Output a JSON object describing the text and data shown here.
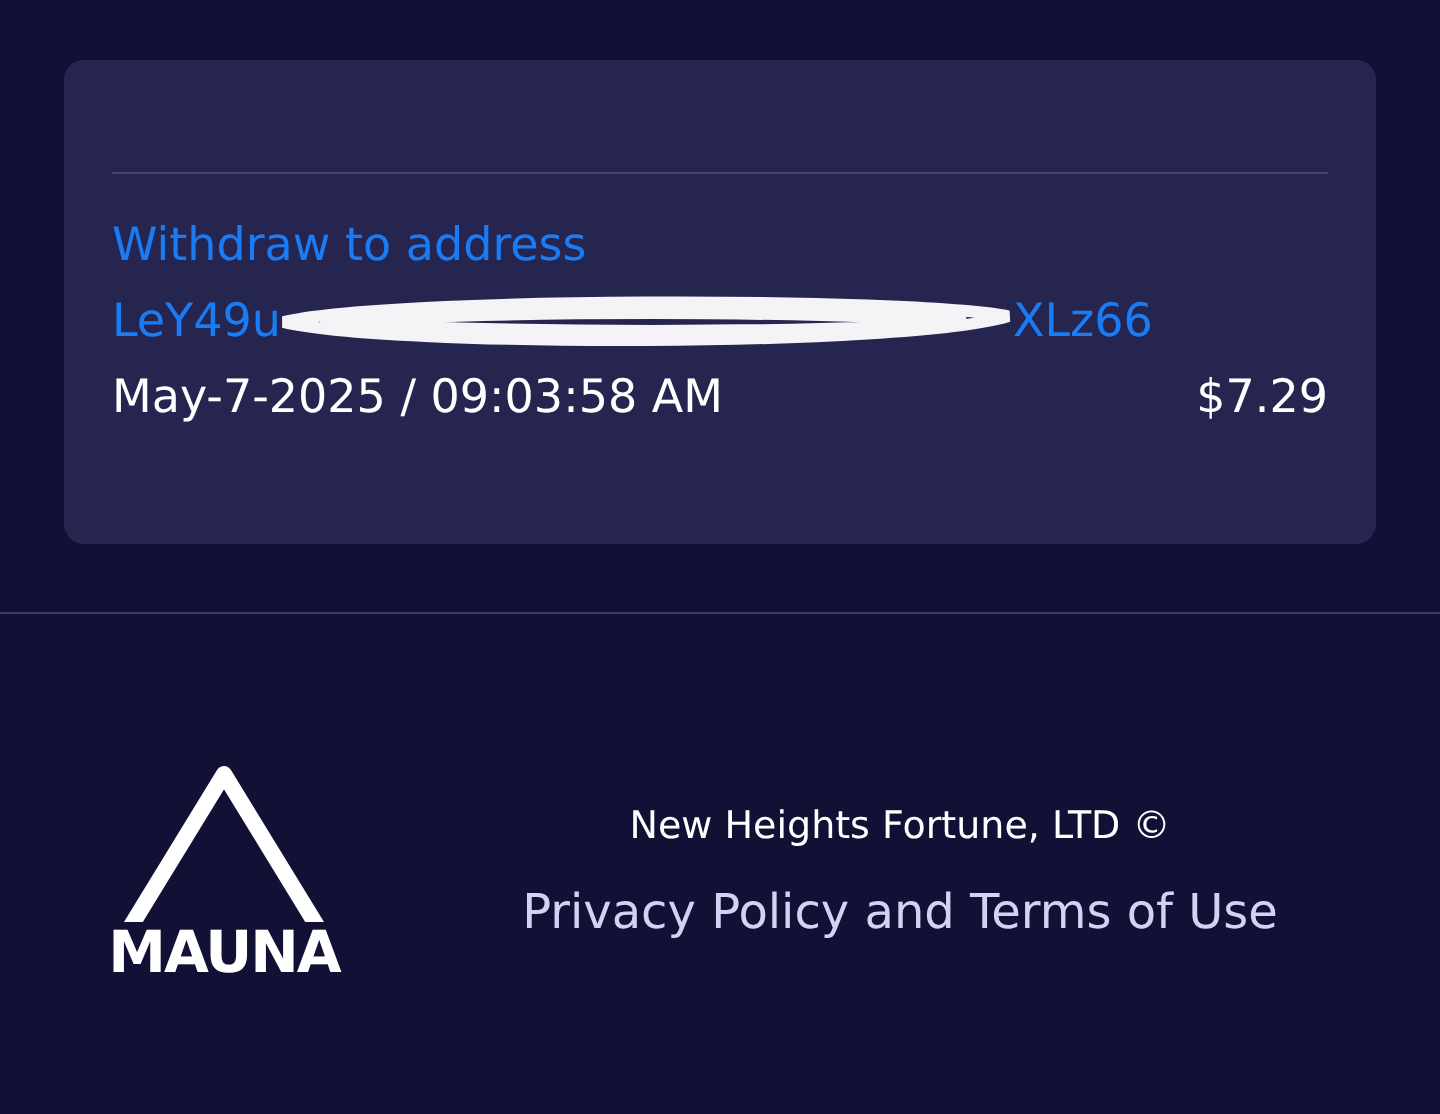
{
  "transaction": {
    "title": "Withdraw to address",
    "address_start": "LeY49u",
    "address_end": "XLz66",
    "redacted": true,
    "datetime": "May-7-2025 / 09:03:58 AM",
    "amount": "$7.29"
  },
  "footer": {
    "logo_text": "MAUNA",
    "company": "New Heights Fortune, LTD ©",
    "legal_link": "Privacy Policy and Terms of Use"
  }
}
